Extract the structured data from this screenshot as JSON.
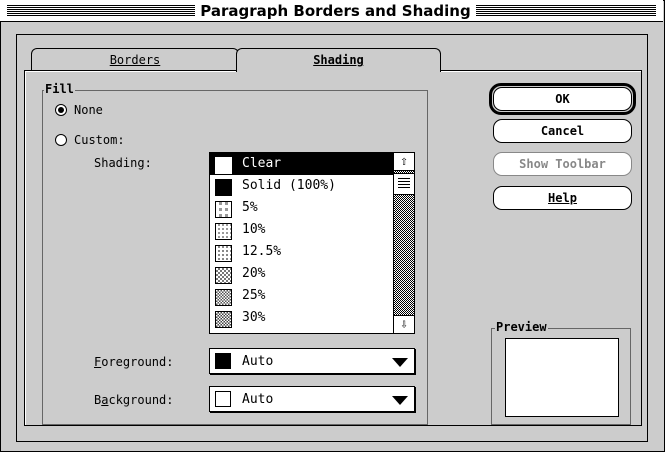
{
  "window": {
    "title": "Paragraph Borders and Shading"
  },
  "tabs": [
    {
      "label": "Borders",
      "active": false
    },
    {
      "label": "Shading",
      "active": true
    }
  ],
  "fill": {
    "group_label": "Fill",
    "none_label": "None",
    "custom_label": "Custom:",
    "selected_option": "None",
    "shading_label": "Shading:",
    "shading_options": [
      {
        "label": "Clear",
        "selected": true
      },
      {
        "label": "Solid (100%)",
        "selected": false
      },
      {
        "label": "5%",
        "selected": false
      },
      {
        "label": "10%",
        "selected": false
      },
      {
        "label": "12.5%",
        "selected": false
      },
      {
        "label": "20%",
        "selected": false
      },
      {
        "label": "25%",
        "selected": false
      },
      {
        "label": "30%",
        "selected": false
      }
    ],
    "foreground_label": "Foreground:",
    "foreground_value": "Auto",
    "background_label": "Background:",
    "background_value": "Auto"
  },
  "buttons": {
    "ok": "OK",
    "cancel": "Cancel",
    "show_toolbar": "Show Toolbar",
    "help": "Help"
  },
  "preview": {
    "label": "Preview"
  },
  "icons": {
    "scroll_up": "up-arrow-icon",
    "scroll_down": "down-arrow-icon",
    "dropdown": "triangle-down-icon"
  }
}
